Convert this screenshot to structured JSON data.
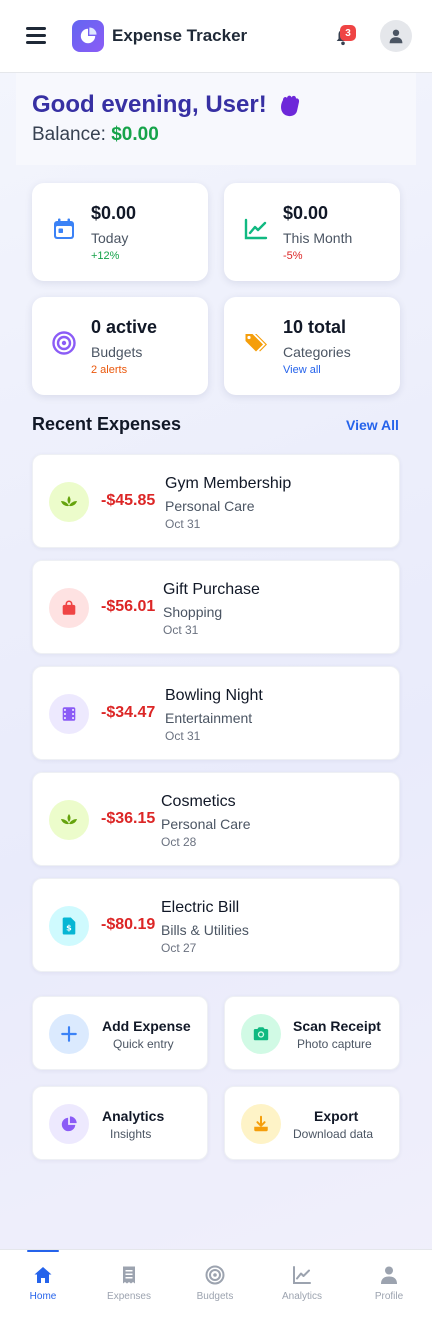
{
  "header": {
    "title": "Expense Tracker",
    "notification_count": "3"
  },
  "greeting": {
    "title": "Good evening, User!",
    "balance_label": "Balance:",
    "balance_value": "$0.00"
  },
  "stats": [
    {
      "value": "$0.00",
      "label": "Today",
      "sub": "+12%",
      "icon": "calendar-icon",
      "color": "#3b82f6",
      "sub_color": "#16a34a"
    },
    {
      "value": "$0.00",
      "label": "This Month",
      "sub": "-5%",
      "icon": "chart-line-icon",
      "color": "#10b981",
      "sub_color": "#dc2626"
    },
    {
      "value": "0 active",
      "label": "Budgets",
      "sub": "2 alerts",
      "icon": "target-icon",
      "color": "#8b5cf6",
      "sub_color": "#ea580c"
    },
    {
      "value": "10 total",
      "label": "Categories",
      "sub": "View all",
      "icon": "tags-icon",
      "color": "#f59e0b",
      "sub_color": "#2563eb"
    }
  ],
  "recent": {
    "title": "Recent Expenses",
    "view_all": "View All",
    "items": [
      {
        "amount": "-$45.85",
        "name": "Gym Membership",
        "category": "Personal Care",
        "date": "Oct 31",
        "icon": "spa-icon",
        "bg": "#ecfccb",
        "fg": "#65a30d"
      },
      {
        "amount": "-$56.01",
        "name": "Gift Purchase",
        "category": "Shopping",
        "date": "Oct 31",
        "icon": "shopping-bag-icon",
        "bg": "#fee2e2",
        "fg": "#ef4444"
      },
      {
        "amount": "-$34.47",
        "name": "Bowling Night",
        "category": "Entertainment",
        "date": "Oct 31",
        "icon": "film-icon",
        "bg": "#ede9fe",
        "fg": "#8b5cf6"
      },
      {
        "amount": "-$36.15",
        "name": "Cosmetics",
        "category": "Personal Care",
        "date": "Oct 28",
        "icon": "spa-icon",
        "bg": "#ecfccb",
        "fg": "#65a30d"
      },
      {
        "amount": "-$80.19",
        "name": "Electric Bill",
        "category": "Bills & Utilities",
        "date": "Oct 27",
        "icon": "invoice-icon",
        "bg": "#cffafe",
        "fg": "#06b6d4"
      }
    ]
  },
  "actions": [
    {
      "title": "Add Expense",
      "sub": "Quick entry",
      "icon": "plus-icon",
      "bg": "#dbeafe",
      "fg": "#3b82f6"
    },
    {
      "title": "Scan Receipt",
      "sub": "Photo capture",
      "icon": "camera-icon",
      "bg": "#d1fae5",
      "fg": "#10b981"
    },
    {
      "title": "Analytics",
      "sub": "Insights",
      "icon": "pie-chart-icon",
      "bg": "#ede9fe",
      "fg": "#8b5cf6"
    },
    {
      "title": "Export",
      "sub": "Download data",
      "icon": "download-icon",
      "bg": "#fef3c7",
      "fg": "#f59e0b"
    }
  ],
  "nav": [
    {
      "label": "Home",
      "icon": "home-icon",
      "active": true
    },
    {
      "label": "Expenses",
      "icon": "receipt-icon",
      "active": false
    },
    {
      "label": "Budgets",
      "icon": "target-icon",
      "active": false
    },
    {
      "label": "Analytics",
      "icon": "chart-line-icon",
      "active": false
    },
    {
      "label": "Profile",
      "icon": "user-icon",
      "active": false
    }
  ],
  "colors": {
    "primary": "#2563eb",
    "greeting": "#3730a3",
    "positive": "#16a34a",
    "negative": "#dc2626"
  }
}
